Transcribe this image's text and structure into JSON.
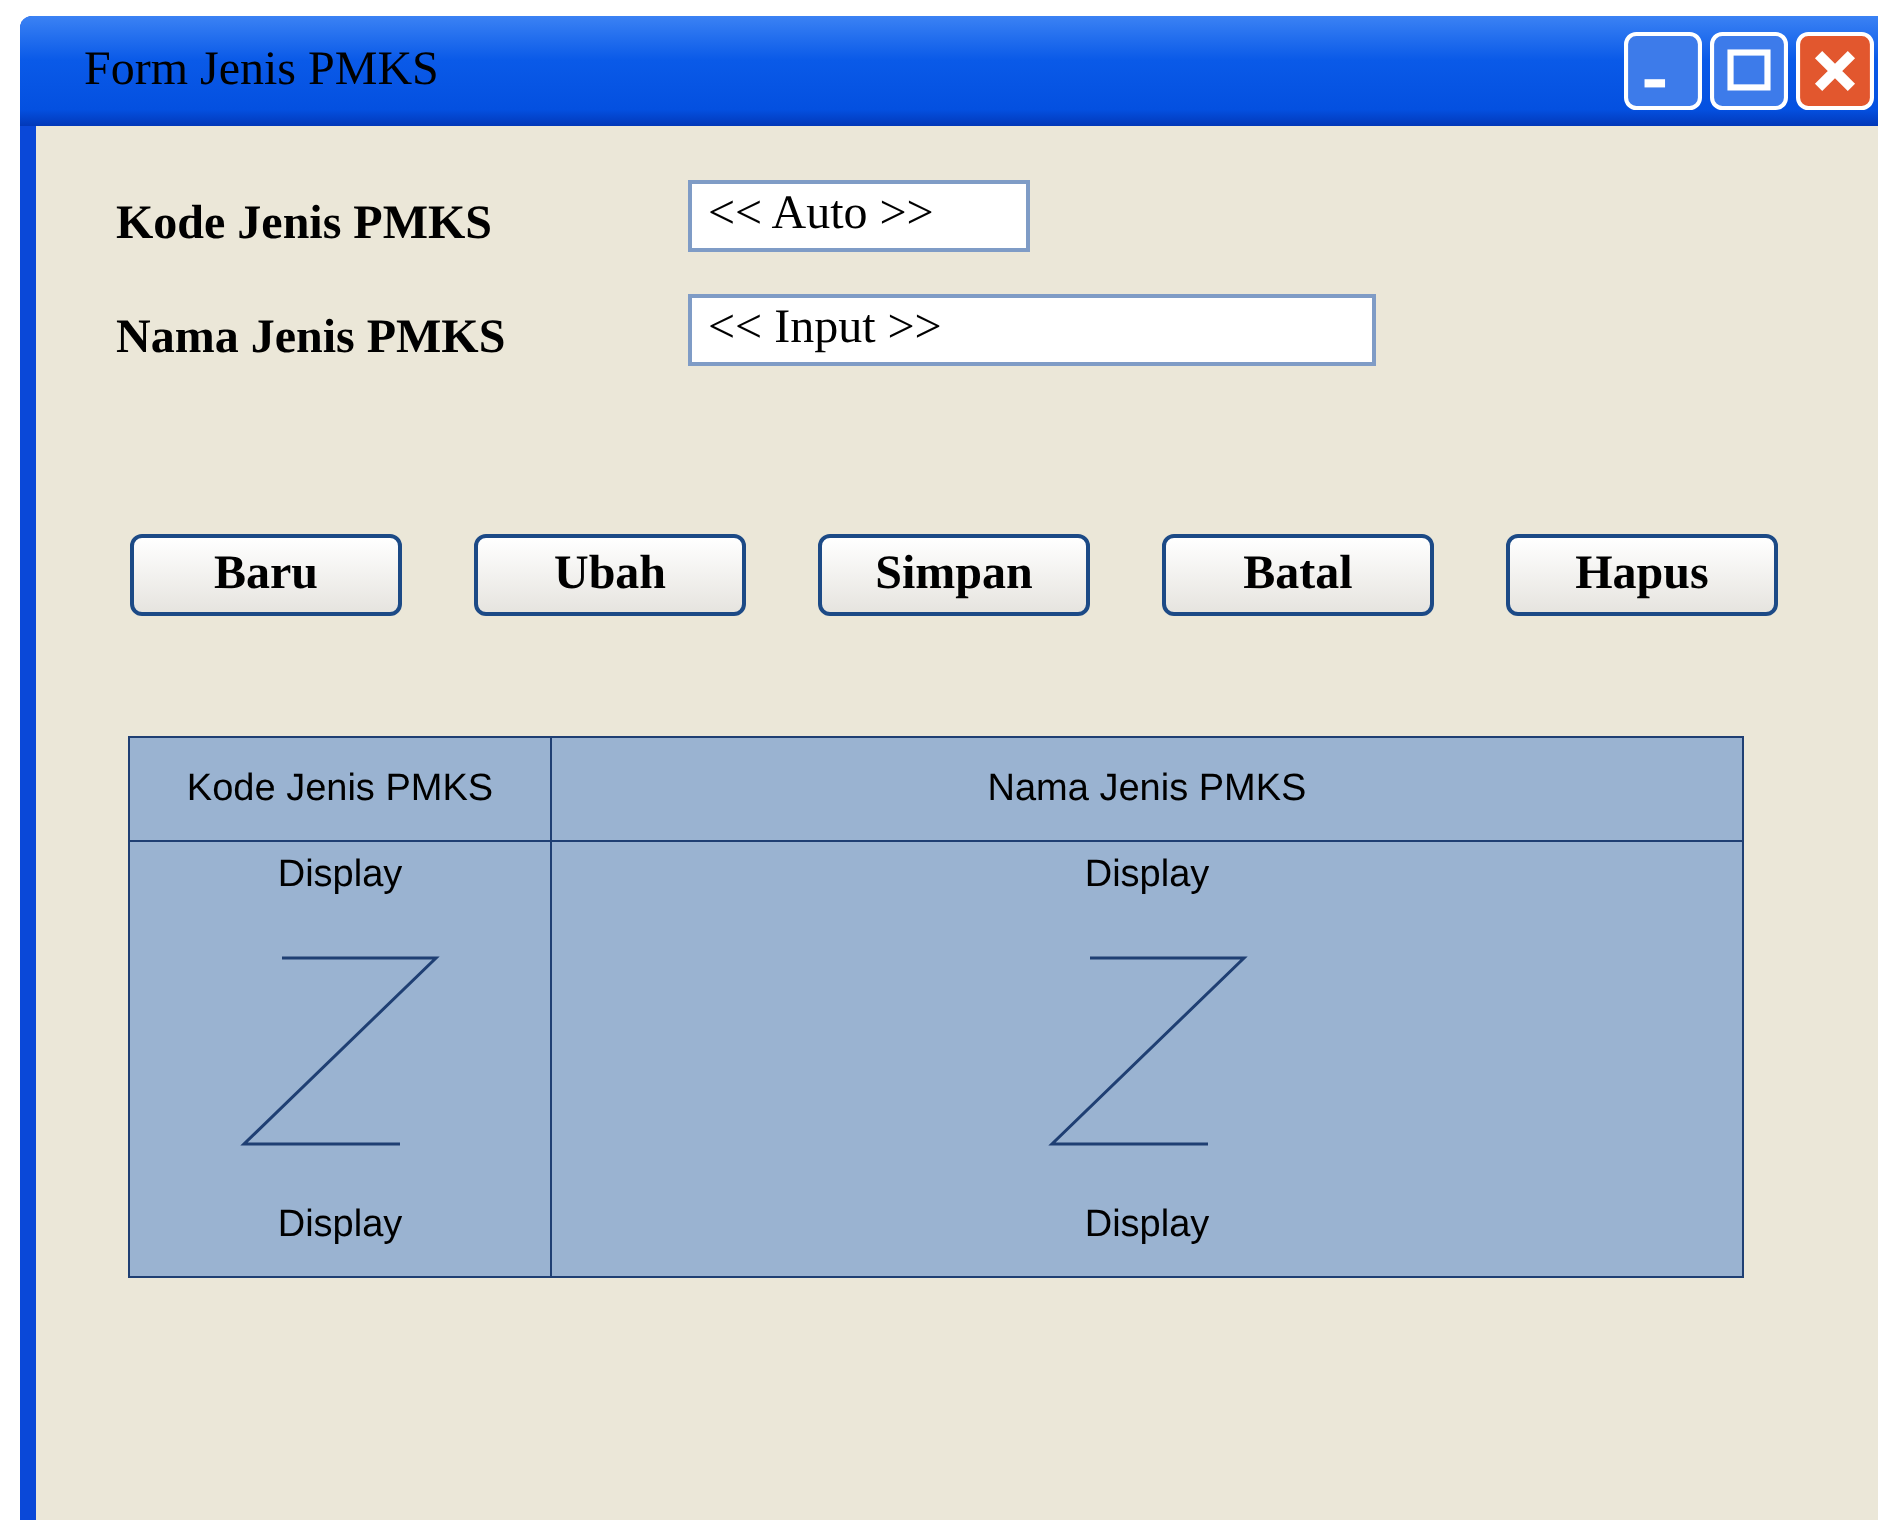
{
  "window": {
    "title": "Form Jenis PMKS"
  },
  "fields": [
    {
      "label": "Kode Jenis PMKS",
      "value": "<< Auto >>"
    },
    {
      "label": "Nama Jenis PMKS",
      "value": "<< Input >>"
    }
  ],
  "buttons": [
    "Baru",
    "Ubah",
    "Simpan",
    "Batal",
    "Hapus"
  ],
  "table": {
    "columns": [
      "Kode Jenis PMKS",
      "Nama Jenis PMKS"
    ],
    "cells": [
      {
        "top": "Display",
        "bottom": "Display"
      },
      {
        "top": "Display",
        "bottom": "Display"
      }
    ]
  }
}
